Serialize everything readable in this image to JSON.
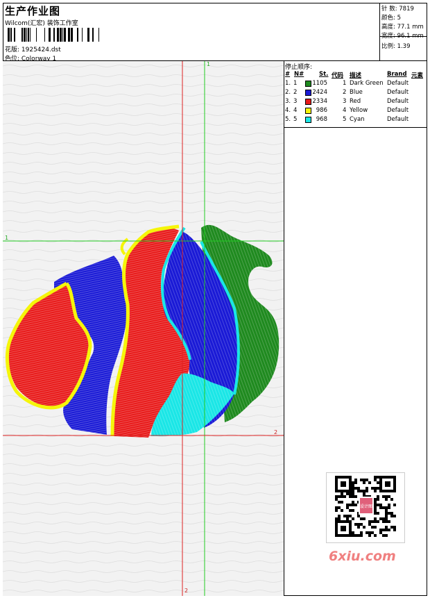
{
  "header": {
    "title": "生产作业图",
    "company": "Wilcom(汇宏) 装饰工作室",
    "pattern_label": "花版: 1925424.dst",
    "colorway_label": "色位: Colorway 1"
  },
  "stats": [
    "针 数: 7819",
    "颜色: 5",
    "高度: 77.1 mm",
    "宽度: 96.1 mm",
    "比例: 1.39"
  ],
  "axes": {
    "h1": "1",
    "v1": "1",
    "h2": "2",
    "v2": "2"
  },
  "colors": {
    "dark_green": "#1f8a1f",
    "blue": "#1a1ad6",
    "red": "#e81a1a",
    "yellow": "#f5f50a",
    "cyan": "#1ae6e6"
  },
  "stop_table": {
    "title": "停止顺序:",
    "headers": {
      "num": "#",
      "n": "N#",
      "st": "St.",
      "code": "代码",
      "desc": "描述",
      "brand": "Brand",
      "elem": "元素"
    },
    "rows": [
      {
        "num": "1.",
        "n": "1",
        "st": "1105",
        "code": "1",
        "desc": "Dark Green",
        "brand": "Default",
        "color": "#1f8a1f"
      },
      {
        "num": "2.",
        "n": "2",
        "st": "2424",
        "code": "2",
        "desc": "Blue",
        "brand": "Default",
        "color": "#1a1ad6"
      },
      {
        "num": "3.",
        "n": "3",
        "st": "2334",
        "code": "3",
        "desc": "Red",
        "brand": "Default",
        "color": "#e81a1a"
      },
      {
        "num": "4.",
        "n": "4",
        "st": "986",
        "code": "4",
        "desc": "Yellow",
        "brand": "Default",
        "color": "#f5f50a"
      },
      {
        "num": "5.",
        "n": "5",
        "st": "968",
        "code": "5",
        "desc": "Cyan",
        "brand": "Default",
        "color": "#1ae6e6"
      }
    ]
  },
  "watermark": "6xiu.com",
  "qr_badge": "设计图"
}
